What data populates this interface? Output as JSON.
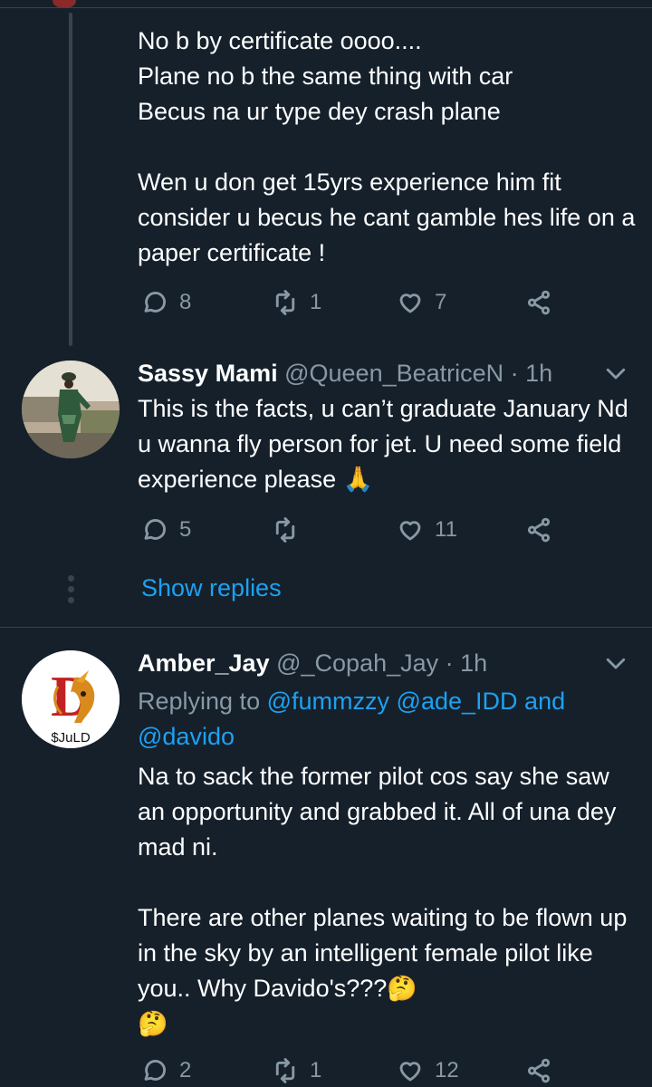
{
  "tweet1": {
    "text": "No b by certificate oooo....\nPlane no b the same thing with car\nBecus na ur type dey crash plane\n\nWen u don get 15yrs experience him fit consider u becus he cant gamble hes life on a paper certificate !",
    "replies": "8",
    "retweets": "1",
    "likes": "7"
  },
  "tweet2": {
    "name": "Sassy Mami",
    "handle": "@Queen_BeatriceN",
    "time": "· 1h",
    "text": "This is the facts, u can’t graduate January Nd u wanna fly person for jet. U need some field experience please 🙏",
    "replies": "5",
    "retweets": "",
    "likes": "11"
  },
  "show_replies": "Show replies",
  "tweet3": {
    "name": "Amber_Jay",
    "handle": "@_Copah_Jay",
    "time": "· 1h",
    "replying_prefix": "Replying to",
    "mention1": "@fummzzy",
    "mention2": "@ade_IDD",
    "and": "and",
    "mention3": "@davido",
    "text_p1": "Na to sack the former pilot cos say she saw an opportunity and grabbed it. All of una dey mad ni.",
    "text_p2": "There are other planes waiting to be flown up in the sky by an intelligent female pilot like you.. Why Davido's???🤔\n🤔",
    "avatar_text": "$JuLD",
    "avatar_letter": "D",
    "replies": "2",
    "retweets": "1",
    "likes": "12"
  },
  "colors": {
    "background": "#15202b",
    "text": "#ffffff",
    "secondary": "#8899a6",
    "link": "#1da1f2",
    "divider": "#38444d"
  }
}
